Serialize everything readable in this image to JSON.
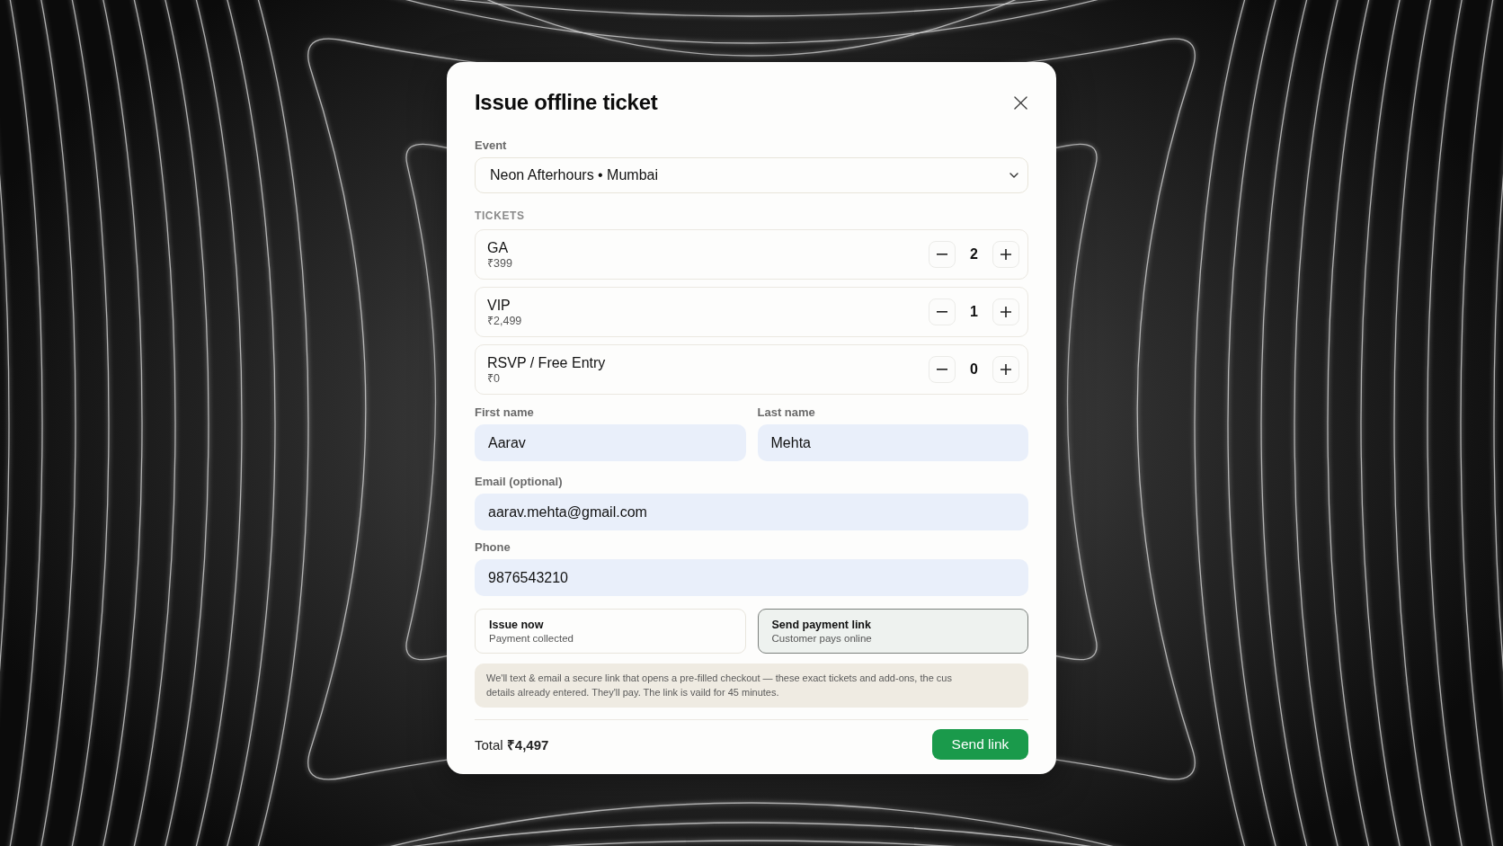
{
  "dialog": {
    "title": "Issue offline ticket"
  },
  "event": {
    "label": "Event",
    "value": "Neon Afterhours • Mumbai"
  },
  "tickets": {
    "heading": "TICKETS",
    "items": [
      {
        "name": "GA",
        "price": "₹399",
        "quantity": "2"
      },
      {
        "name": "VIP",
        "price": "₹2,499",
        "quantity": "1"
      },
      {
        "name": "RSVP / Free Entry",
        "price": "₹0",
        "quantity": "0"
      }
    ]
  },
  "name_fields": [
    {
      "label": "First name",
      "value": "Aarav"
    },
    {
      "label": "Last name",
      "value": "Mehta"
    }
  ],
  "email": {
    "label": "Email (optional)",
    "value": "aarav.mehta@gmail.com"
  },
  "phone": {
    "label": "Phone",
    "value": "9876543210"
  },
  "payment_modes": [
    {
      "title": "Issue now",
      "subtitle": "Payment collected",
      "selected": false
    },
    {
      "title": "Send payment link",
      "subtitle": "Customer pays online",
      "selected": true
    }
  ],
  "notice": {
    "lines": [
      "We'll text & email a secure link that opens a pre-filled checkout — these exact tickets and add-ons, the cus",
      "details already entered. They'll pay. The link is vaild for 45 minutes."
    ]
  },
  "footer": {
    "total": "Total **₹4,497**",
    "button": "Send link"
  }
}
